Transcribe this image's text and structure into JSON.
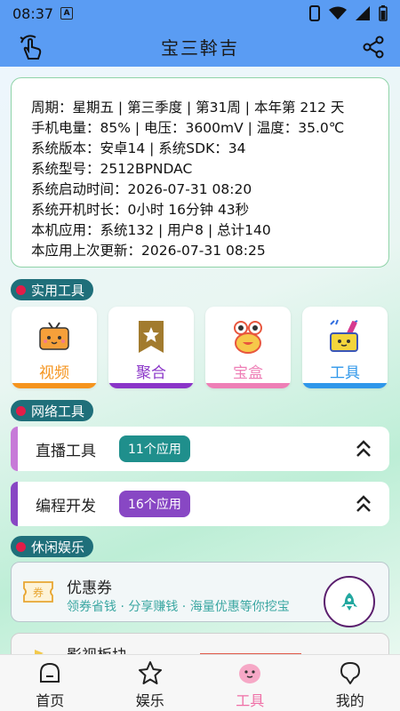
{
  "status_bar": {
    "time": "08:37",
    "notif_letter": "A"
  },
  "header": {
    "title": "宝三斡吉"
  },
  "info": {
    "lines": [
      "周期：星期五 | 第三季度 | 第31周 | 本年第 212 天",
      "手机电量：85% | 电压：3600mV | 温度：35.0℃",
      "系统版本：安卓14 | 系统SDK：34",
      "系统型号：2512BPNDAC",
      "系统启动时间：2026-07-31 08:20",
      "系统开机时长：0小时 16分钟 43秒",
      "本机应用：系统132 | 用户8 | 总计140",
      "本应用上次更新：2026-07-31 08:25"
    ]
  },
  "sections": {
    "practical": "实用工具",
    "network": "网络工具",
    "leisure": "休闲娱乐"
  },
  "tools": [
    {
      "label": "视频",
      "icon": "tv-icon",
      "color": "#f5941e"
    },
    {
      "label": "聚合",
      "icon": "bookmark-star-icon",
      "color": "#8a35c8"
    },
    {
      "label": "宝盒",
      "icon": "frog-icon",
      "color": "#ee7fb6"
    },
    {
      "label": "工具",
      "icon": "toolbox-icon",
      "color": "#2f97ea"
    }
  ],
  "network_rows": [
    {
      "name": "直播工具",
      "badge": "11个应用",
      "badge_color": "#1f8f8c",
      "accent": "#c77ad8"
    },
    {
      "name": "编程开发",
      "badge": "16个应用",
      "badge_color": "#8847c4",
      "accent": "#8847c4"
    }
  ],
  "coupon": {
    "icon_text": "券",
    "title": "优惠券",
    "subtitle": "领券省钱 · 分享赚钱 · 海量优惠等你挖宝"
  },
  "partial_card": {
    "title": "影视板块"
  },
  "bottom_nav": [
    {
      "label": "首页",
      "active": false
    },
    {
      "label": "娱乐",
      "active": false
    },
    {
      "label": "工具",
      "active": true
    },
    {
      "label": "我的",
      "active": false
    }
  ],
  "colors": {
    "primary": "#5a9cf3",
    "active_tab": "#ef6fa6",
    "section_bg": "#1f6f7a"
  }
}
